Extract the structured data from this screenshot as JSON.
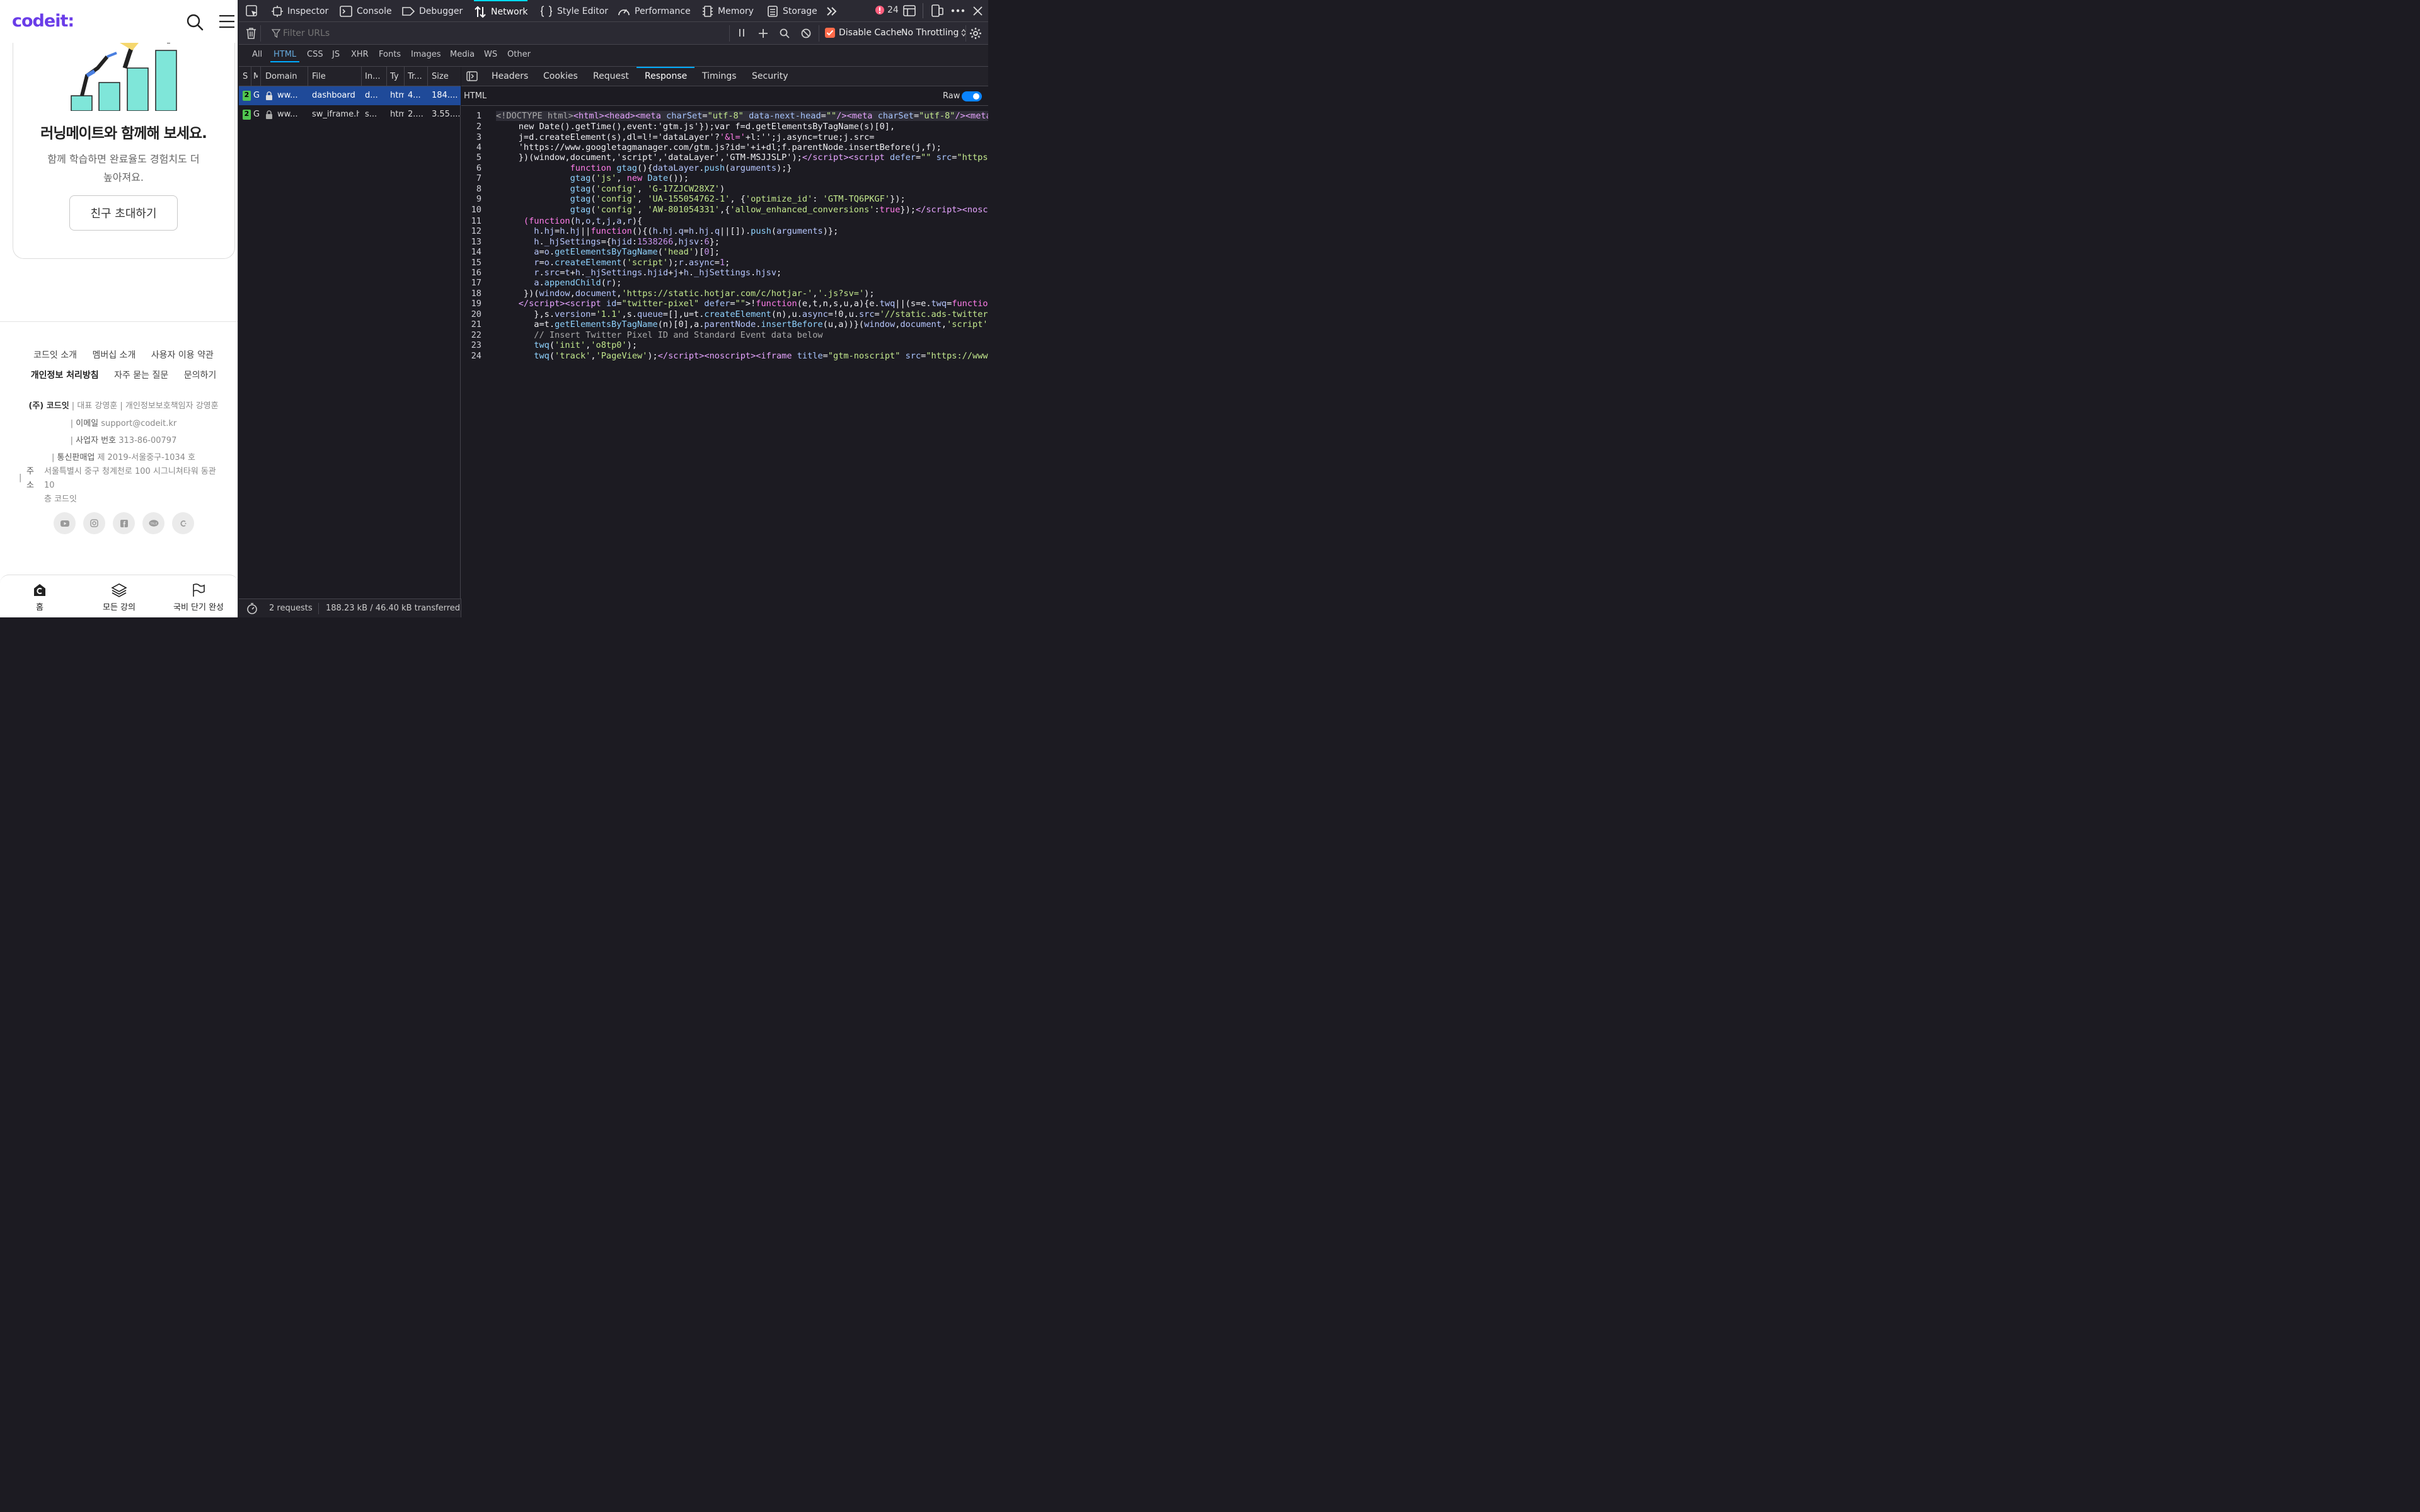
{
  "mobile": {
    "logo": "codeit:",
    "card": {
      "title": "러닝메이트와 함께해 보세요.",
      "desc_line1": "함께 학습하면 완료율도 경험치도 더",
      "desc_line2": "높아져요.",
      "button": "친구 초대하기"
    },
    "footer": {
      "links_row1": [
        "코드잇 소개",
        "멤버십 소개",
        "사용자 이용 약관"
      ],
      "links_row2": [
        "개인정보 처리방침",
        "자주 묻는 질문",
        "문의하기"
      ],
      "company": "(주) 코드잇",
      "ceo_label": "대표",
      "ceo": "강영훈",
      "privacy_label": "개인정보보호책임자",
      "privacy_officer": "강영훈",
      "email_label": "이메일",
      "email": "support@codeit.kr",
      "biz_label": "사업자 번호",
      "biz_no": "313-86-00797",
      "mail_order_label": "통신판매업",
      "mail_order_no": "제 2019-서울중구-1034 호",
      "addr_label": "주소",
      "addr_line1": "서울특별시 중구 청계천로 100 시그니쳐타워 동관 10",
      "addr_line2": "층 코드잇",
      "socials": [
        "youtube-icon",
        "instagram-icon",
        "facebook-icon",
        "kakaotalk-icon",
        "codeit-icon"
      ]
    },
    "bottom_nav": [
      "홈",
      "모든 강의",
      "국비 단기 완성"
    ]
  },
  "devtools": {
    "tabs": [
      "Inspector",
      "Console",
      "Debugger",
      "Network",
      "Style Editor",
      "Performance",
      "Memory",
      "Storage"
    ],
    "active_tab": "Network",
    "error_count": "24",
    "filter_placeholder": "Filter URLs",
    "disable_cache": "Disable Cache",
    "throttling": "No Throttling",
    "type_filters": [
      "All",
      "HTML",
      "CSS",
      "JS",
      "XHR",
      "Fonts",
      "Images",
      "Media",
      "WS",
      "Other"
    ],
    "active_filter": "HTML",
    "columns": [
      "S",
      "M",
      "Domain",
      "File",
      "In...",
      "Ty",
      "Tr...",
      "Size"
    ],
    "requests": [
      {
        "status": "2",
        "method": "GI",
        "domain": "ww...",
        "file": "dashboard",
        "initiator": "d...",
        "type": "htm",
        "transferred": "4...",
        "size": "184...."
      },
      {
        "status": "2",
        "method": "GI",
        "domain": "ww...",
        "file": "sw_iframe.ht",
        "initiator": "s...",
        "type": "htm",
        "transferred": "2....",
        "size": "3.55...."
      }
    ],
    "detail_tabs": [
      "Headers",
      "Cookies",
      "Request",
      "Response",
      "Timings",
      "Security"
    ],
    "active_detail_tab": "Response",
    "response_label": "HTML",
    "raw_label": "Raw",
    "summary_requests": "2 requests",
    "summary_transfer": "188.23 kB / 46.40 kB transferred",
    "code_line_numbers": [
      "1",
      "2",
      "3",
      "4",
      "5",
      "6",
      "7",
      "8",
      "9",
      "10",
      "11",
      "12",
      "13",
      "14",
      "15",
      "16",
      "17",
      "18",
      "19",
      "20",
      "21",
      "22",
      "23",
      "24"
    ]
  },
  "colors": {
    "brand": "#6a3de8",
    "devtools_bg": "#1c1b22",
    "selected_row": "#1f4a99",
    "accent": "#00aaff",
    "status_ok": "#50c550"
  }
}
